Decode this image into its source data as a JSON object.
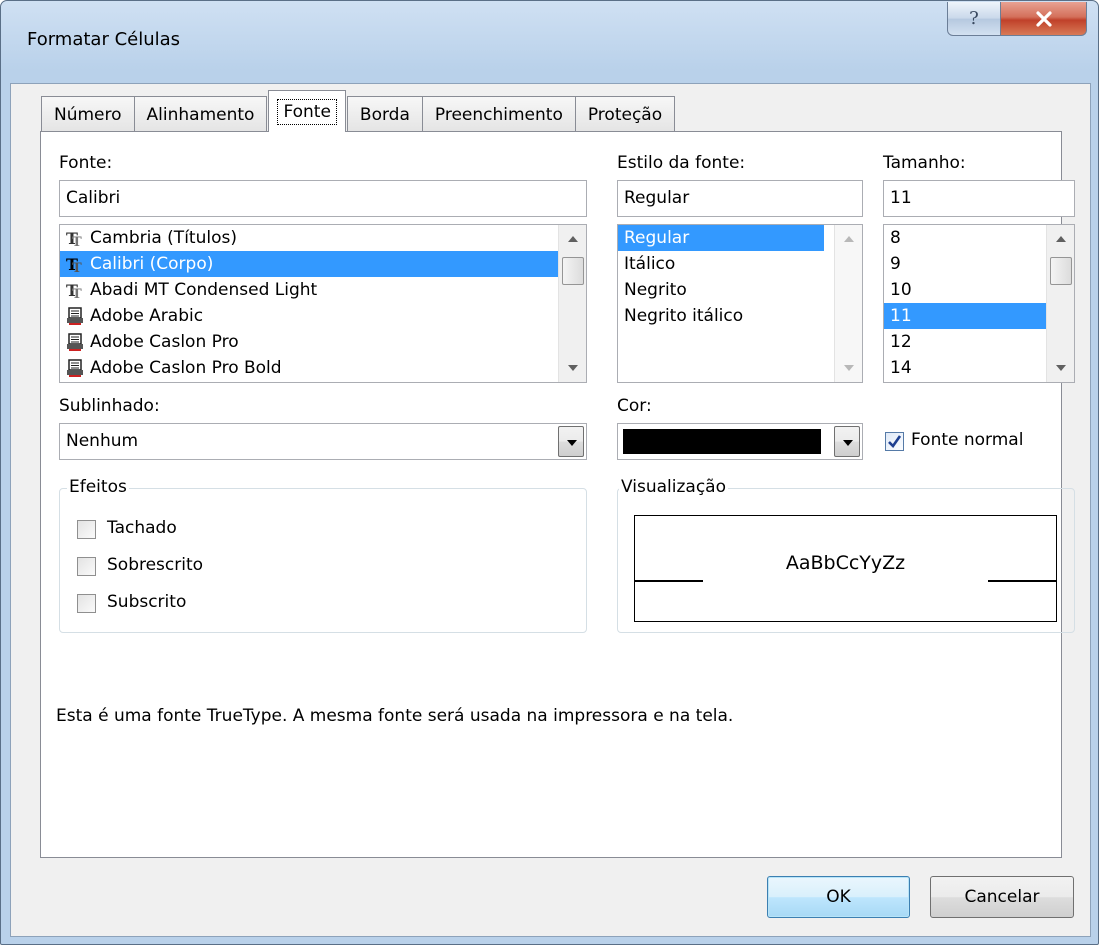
{
  "window": {
    "title": "Formatar Células"
  },
  "tabs": [
    {
      "label": "Número"
    },
    {
      "label": "Alinhamento"
    },
    {
      "label": "Fonte"
    },
    {
      "label": "Borda"
    },
    {
      "label": "Preenchimento"
    },
    {
      "label": "Proteção"
    }
  ],
  "font": {
    "label": "Fonte:",
    "value": "Calibri",
    "items": [
      {
        "label": "Cambria (Títulos)",
        "icon": "truetype-font-icon"
      },
      {
        "label": "Calibri (Corpo)",
        "icon": "truetype-font-icon"
      },
      {
        "label": "Abadi MT Condensed Light",
        "icon": "truetype-font-icon"
      },
      {
        "label": "Adobe Arabic",
        "icon": "printer-font-icon"
      },
      {
        "label": "Adobe Caslon Pro",
        "icon": "printer-font-icon"
      },
      {
        "label": "Adobe Caslon Pro Bold",
        "icon": "printer-font-icon"
      }
    ],
    "selected_index": 1
  },
  "style": {
    "label": "Estilo da fonte:",
    "value": "Regular",
    "items": [
      "Regular",
      "Itálico",
      "Negrito",
      "Negrito itálico"
    ],
    "selected_index": 0
  },
  "size": {
    "label": "Tamanho:",
    "value": "11",
    "items": [
      "8",
      "9",
      "10",
      "11",
      "12",
      "14"
    ],
    "selected_index": 3
  },
  "underline": {
    "label": "Sublinhado:",
    "value": "Nenhum"
  },
  "color": {
    "label": "Cor:",
    "swatch": "#000000"
  },
  "normal_font": {
    "label": "Fonte normal",
    "checked": true
  },
  "effects": {
    "title": "Efeitos",
    "strikethrough": "Tachado",
    "superscript": "Sobrescrito",
    "subscript": "Subscrito"
  },
  "preview": {
    "title": "Visualização",
    "sample": "AaBbCcYyZz"
  },
  "info_text": "Esta é uma fonte TrueType. A mesma fonte será usada na impressora e na tela.",
  "buttons": {
    "ok": "OK",
    "cancel": "Cancelar"
  },
  "colors": {
    "selection": "#3399ff",
    "window_frame": "#b9d1ea",
    "close_button": "#c0412a"
  }
}
